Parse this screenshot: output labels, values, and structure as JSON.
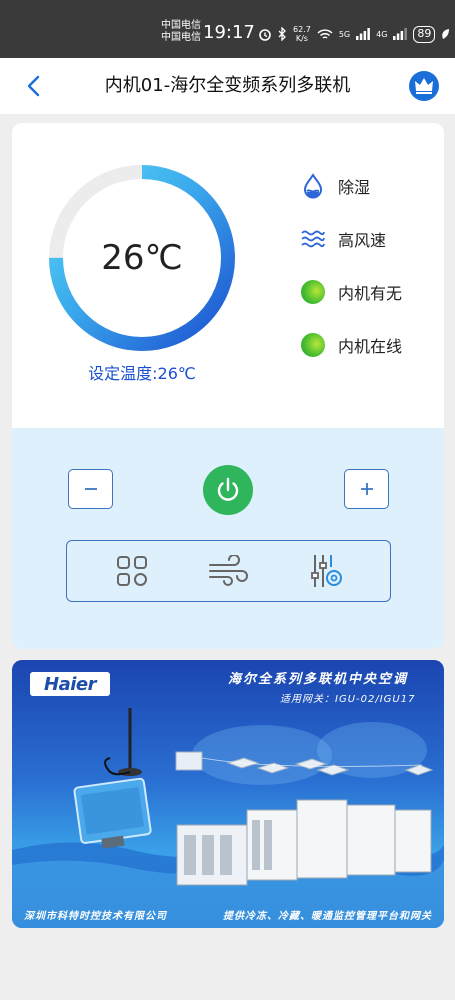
{
  "status_bar": {
    "carrier_1": "中国电信",
    "carrier_2": "中国电信",
    "time": "19:17",
    "net_speed_value": "62.7",
    "net_speed_unit": "K/s",
    "signal_1_label": "5G",
    "signal_2_label": "4G",
    "battery": "89"
  },
  "nav": {
    "title": "内机01-海尔全变频系列多联机",
    "back_icon": "chevron-left-icon",
    "right_icon": "crown-icon"
  },
  "thermostat": {
    "current_temp": "26℃",
    "set_temp_label": "设定温度:26℃",
    "ring_fill_fraction": 0.75
  },
  "status": {
    "items": [
      {
        "icon": "water-drop-icon",
        "label": "除湿"
      },
      {
        "icon": "wind-waves-icon",
        "label": "高风速"
      },
      {
        "icon": "green-dot-icon",
        "label": "内机有无"
      },
      {
        "icon": "green-dot-icon",
        "label": "内机在线"
      }
    ]
  },
  "controls": {
    "minus_icon": "minus-icon",
    "plus_icon": "plus-icon",
    "power_icon": "power-icon",
    "modes": [
      {
        "icon": "grid-apps-icon"
      },
      {
        "icon": "wind-icon"
      },
      {
        "icon": "settings-sliders-icon"
      }
    ]
  },
  "banner": {
    "logo_text": "Haier",
    "title": "海尔全系列多联机中央空调",
    "subtitle": "适用网关：IGU-02/IGU17",
    "footer_left": "深圳市科特时控技术有限公司",
    "footer_right": "提供冷冻、冷藏、暖通监控管理平台和网关"
  },
  "colors": {
    "ring_start": "#1b4fd0",
    "ring_end": "#5ad8f5",
    "power_green": "#2fb65c",
    "accent_blue": "#3c74c2"
  }
}
